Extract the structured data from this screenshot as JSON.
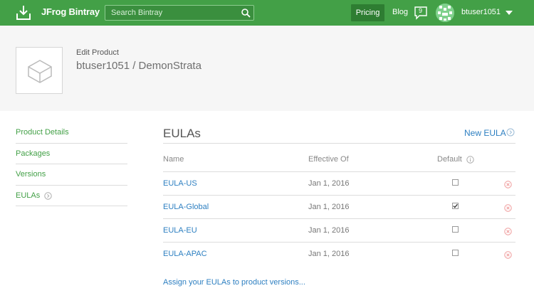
{
  "brand": {
    "name": "JFrog Bintray",
    "accent": "#43a047",
    "link_color": "#2d7fc1"
  },
  "topbar": {
    "search_placeholder": "Search Bintray",
    "pricing_label": "Pricing",
    "blog_label": "Blog",
    "notification_count": "9",
    "username": "btuser1051",
    "icons": [
      "bintray-logo-icon",
      "search-icon",
      "chat-icon",
      "avatar",
      "caret-down-icon"
    ]
  },
  "header": {
    "edit_label": "Edit Product",
    "product_path": "btuser1051 / DemonStrata"
  },
  "sidenav": {
    "items": [
      {
        "label": "Product Details"
      },
      {
        "label": "Packages"
      },
      {
        "label": "Versions"
      },
      {
        "label": "EULAs",
        "active": true
      }
    ]
  },
  "main": {
    "title": "EULAs",
    "new_eula_label": "New EULA",
    "columns": {
      "name": "Name",
      "effective": "Effective Of",
      "default": "Default"
    },
    "rows": [
      {
        "name": "EULA-US",
        "effective": "Jan 1, 2016",
        "default": false
      },
      {
        "name": "EULA-Global",
        "effective": "Jan 1, 2016",
        "default": true
      },
      {
        "name": "EULA-EU",
        "effective": "Jan 1, 2016",
        "default": false
      },
      {
        "name": "EULA-APAC",
        "effective": "Jan 1, 2016",
        "default": false
      }
    ],
    "assign_link": "Assign your EULAs to product versions..."
  }
}
